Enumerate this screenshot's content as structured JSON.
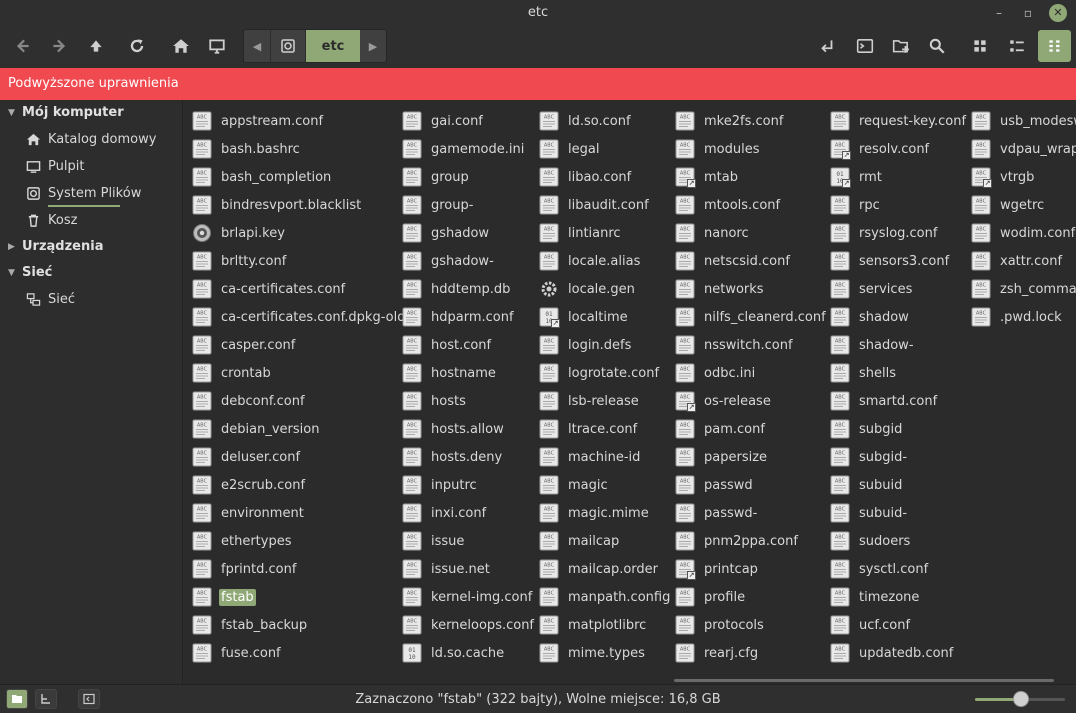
{
  "window": {
    "title": "etc"
  },
  "toolbar": {
    "path_current": "etc",
    "buttons": [
      "back-icon",
      "forward-icon",
      "up-icon",
      "reload-icon",
      "home-icon",
      "computer-icon",
      "terminal-icon",
      "new-folder-icon",
      "search-icon",
      "icon-view-icon",
      "list-view-icon",
      "compact-view-icon"
    ]
  },
  "banner": {
    "text": "Podwyższone uprawnienia",
    "color": "#f04a50"
  },
  "sidebar": {
    "my_computer": "Mój komputer",
    "items": [
      {
        "label": "Katalog domowy",
        "icon": "home-icon"
      },
      {
        "label": "Pulpit",
        "icon": "desktop-icon"
      },
      {
        "label": "System Plików",
        "icon": "drive-icon"
      },
      {
        "label": "Kosz",
        "icon": "trash-icon"
      }
    ],
    "devices": "Urządzenia",
    "network": "Sieć",
    "network_item": {
      "label": "Sieć",
      "icon": "network-icon"
    }
  },
  "files": [
    [
      "appstream.conf",
      "bash.bashrc",
      "bash_completion",
      "bindresvport.blacklist",
      "brlapi.key",
      "brltty.conf",
      "ca-certificates.conf",
      "ca-certificates.conf.dpkg-old",
      "casper.conf",
      "crontab",
      "debconf.conf",
      "debian_version",
      "deluser.conf",
      "e2scrub.conf",
      "environment",
      "ethertypes",
      "fprintd.conf",
      "fstab",
      "fstab_backup",
      "fuse.conf"
    ],
    [
      "gai.conf",
      "gamemode.ini",
      "group",
      "group-",
      "gshadow",
      "gshadow-",
      "hddtemp.db",
      "hdparm.conf",
      "host.conf",
      "hostname",
      "hosts",
      "hosts.allow",
      "hosts.deny",
      "inputrc",
      "inxi.conf",
      "issue",
      "issue.net",
      "kernel-img.conf",
      "kerneloops.conf",
      "ld.so.cache"
    ],
    [
      "ld.so.conf",
      "legal",
      "libao.conf",
      "libaudit.conf",
      "lintianrc",
      "locale.alias",
      "locale.gen",
      "localtime",
      "login.defs",
      "logrotate.conf",
      "lsb-release",
      "ltrace.conf",
      "machine-id",
      "magic",
      "magic.mime",
      "mailcap",
      "mailcap.order",
      "manpath.config",
      "matplotlibrc",
      "mime.types"
    ],
    [
      "mke2fs.conf",
      "modules",
      "mtab",
      "mtools.conf",
      "nanorc",
      "netscsid.conf",
      "networks",
      "nilfs_cleanerd.conf",
      "nsswitch.conf",
      "odbc.ini",
      "os-release",
      "pam.conf",
      "papersize",
      "passwd",
      "passwd-",
      "pnm2ppa.conf",
      "printcap",
      "profile",
      "protocols",
      "rearj.cfg"
    ],
    [
      "request-key.conf",
      "resolv.conf",
      "rmt",
      "rpc",
      "rsyslog.conf",
      "sensors3.conf",
      "services",
      "shadow",
      "shadow-",
      "shells",
      "smartd.conf",
      "subgid",
      "subgid-",
      "subuid",
      "subuid-",
      "sudoers",
      "sysctl.conf",
      "timezone",
      "ucf.conf",
      "updatedb.conf"
    ],
    [
      "usb_modeswitch.conf",
      "vdpau_wrapper.cfg",
      "vtrgb",
      "wgetrc",
      "wodim.conf",
      "xattr.conf",
      "zsh_command_not_found",
      ".pwd.lock"
    ]
  ],
  "selected_file": "fstab",
  "special_icons": {
    "brlapi.key": "key",
    "locale.gen": "gear",
    "ld.so.cache": "binary",
    "localtime": "binary-link",
    "rmt": "binary-link",
    "mtab": "link",
    "os-release": "link",
    "printcap": "link",
    "resolv.conf": "link",
    "vtrgb": "link"
  },
  "statusbar": {
    "text": "Zaznaczono \"fstab\" (322 bajty), Wolne miejsce: 16,8 GB",
    "zoom_level": 0.45
  },
  "colors": {
    "accent": "#8fa876",
    "banner": "#f04a50",
    "background": "#2b2b2b"
  }
}
